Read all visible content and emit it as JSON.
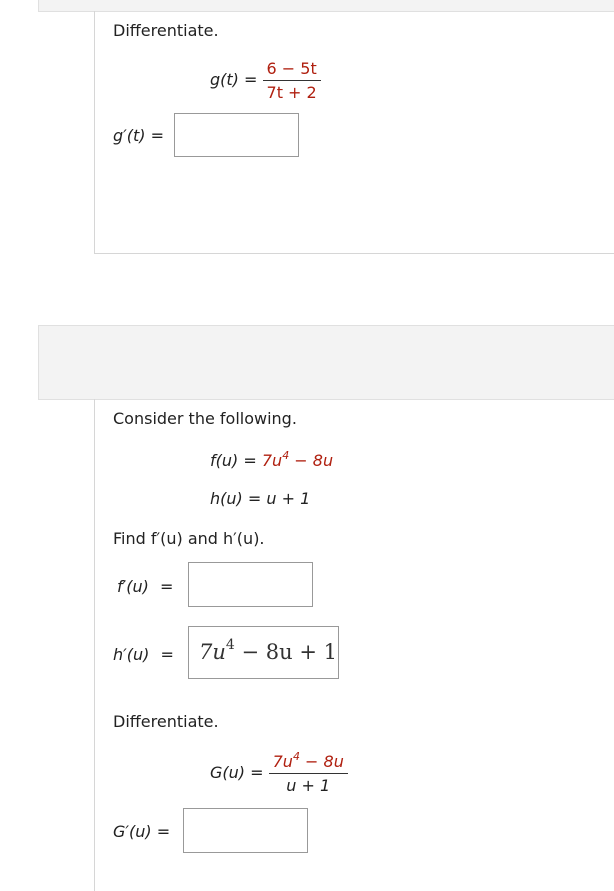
{
  "problem1": {
    "instruction": "Differentiate.",
    "func_lhs": "g(t)",
    "equals": "=",
    "numerator": "6 − 5t",
    "denominator": "7t + 2",
    "answer_label": "g′(t)",
    "answer_value": ""
  },
  "problem2": {
    "intro": "Consider the following.",
    "f_lhs": "f(u)",
    "f_rhs_coef": "7u",
    "f_rhs_exp": "4",
    "f_rhs_rest": " − 8u",
    "h_lhs": "h(u)",
    "h_rhs": "u + 1",
    "find_text": "Find f′(u) and h′(u).",
    "fprime_label": "f′(u)",
    "fprime_value": "",
    "hprime_label": "h′(u)",
    "hprime_value_coef": "7u",
    "hprime_value_exp": "4",
    "hprime_value_rest": " − 8u + 1",
    "instruction": "Differentiate.",
    "G_lhs": "G(u)",
    "G_num_coef": "7u",
    "G_num_exp": "4",
    "G_num_rest": " − 8u",
    "G_den": "u + 1",
    "Gprime_label": "G′(u)",
    "Gprime_value": ""
  }
}
